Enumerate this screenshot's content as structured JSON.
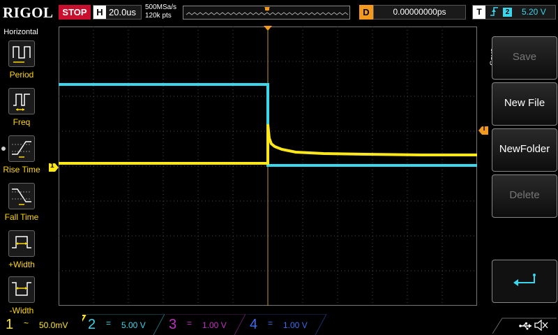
{
  "header": {
    "brand": "RIGOL",
    "run_state": "STOP",
    "horizontal": {
      "label": "H",
      "timebase": "20.0us"
    },
    "acquisition": {
      "sample_rate": "500MSa/s",
      "memory_depth": "120k pts"
    },
    "trigger_delay": {
      "label": "D",
      "value": "0.00000000ps"
    },
    "trigger": {
      "label": "T",
      "edge": "rising-edge-icon",
      "source": "2",
      "level": "5.20 V"
    }
  },
  "left_menu": {
    "title": "Horizontal",
    "items": [
      {
        "label": "Period",
        "icon": "period-measure-icon"
      },
      {
        "label": "Freq",
        "icon": "frequency-measure-icon"
      },
      {
        "label": "Rise Time",
        "icon": "rise-time-icon"
      },
      {
        "label": "Fall Time",
        "icon": "fall-time-icon"
      },
      {
        "label": "+Width",
        "icon": "positive-width-icon"
      },
      {
        "label": "-Width",
        "icon": "negative-width-icon"
      }
    ]
  },
  "screen": {
    "ch1_marker": "1",
    "trigger_marker": "T",
    "colors": {
      "ch1": "#ffe81a",
      "ch2": "#3ad6ec",
      "ch3": "#c42fc4",
      "ch4": "#3a6ff0",
      "trigger": "#f39a1e",
      "grid": "#4a4a4a"
    }
  },
  "right_menu": {
    "title": "Save",
    "softkeys": [
      {
        "label": "Save",
        "enabled": false
      },
      {
        "label": "New File",
        "enabled": true
      },
      {
        "label": "NewFolder",
        "enabled": true
      },
      {
        "label": "Delete",
        "enabled": false
      },
      {
        "label": "",
        "icon": "return-arrow-icon",
        "enabled": true
      }
    ]
  },
  "channels": [
    {
      "num": "1",
      "coupling": "~",
      "scale": "50.0mV",
      "active": true
    },
    {
      "num": "2",
      "coupling": "=",
      "scale": "5.00 V",
      "active": false
    },
    {
      "num": "3",
      "coupling": "=",
      "scale": "1.00 V",
      "active": false
    },
    {
      "num": "4",
      "coupling": "=",
      "scale": "1.00 V",
      "active": false
    }
  ],
  "status": {
    "usb_icon": "usb-icon",
    "sound_icon": "speaker-muted-icon"
  }
}
